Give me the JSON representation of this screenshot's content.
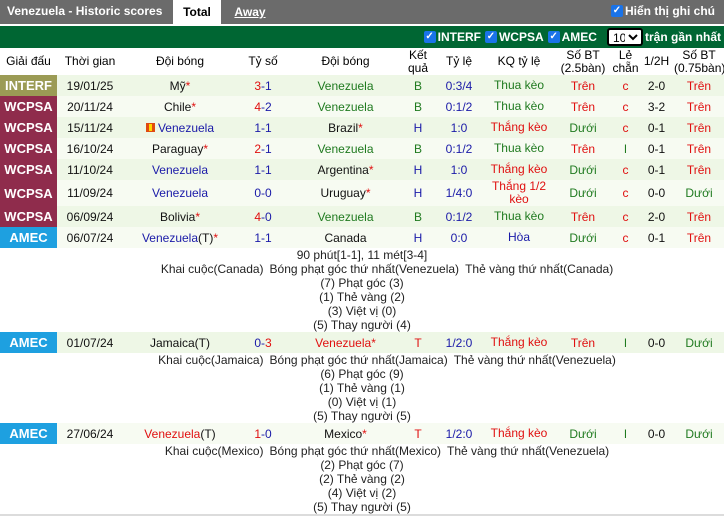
{
  "header": {
    "title": "Venezuela - Historic scores",
    "tabs": [
      {
        "label": "Total",
        "active": true
      },
      {
        "label": "Away",
        "active": false
      }
    ],
    "show_notes_label": "Hiển thị ghi chú",
    "show_notes_checked": true
  },
  "filters": {
    "items": [
      {
        "label": "INTERF",
        "checked": true
      },
      {
        "label": "WCPSA",
        "checked": true
      },
      {
        "label": "AMEC",
        "checked": true
      }
    ],
    "count_value": "10",
    "count_suffix": "trận gần nhất"
  },
  "columns": [
    "Giải đấu",
    "Thời gian",
    "Đội bóng",
    "Tỷ số",
    "Đội bóng",
    "Kết quả",
    "Tỷ lệ",
    "KQ tỷ lệ",
    "Số BT (2.5bàn)",
    "Lẻ chẵn",
    "1/2H",
    "Số BT (0.75bàn)"
  ],
  "colors": {
    "interf": "#9b9b55",
    "wcpsa": "#8f2c4c",
    "amec": "#1ea0e0",
    "green_bar": "#006633",
    "top_bar": "#6b6b6b"
  },
  "matches": [
    {
      "league": "INTERF",
      "date": "19/01/25",
      "home": "Mỹ",
      "home_star": "*",
      "score_home": "3",
      "score_away": "1",
      "away": "Venezuela",
      "away_star": "",
      "result": "B",
      "odds": "0:3/4",
      "odds_result": "Thua kèo",
      "ou": "Trên",
      "oe": "c",
      "half": "2-0",
      "ou2": "Trên"
    },
    {
      "league": "WCPSA",
      "date": "20/11/24",
      "home": "Chile",
      "home_star": "*",
      "score_home": "4",
      "score_away": "2",
      "away": "Venezuela",
      "away_star": "",
      "result": "B",
      "odds": "0:1/2",
      "odds_result": "Thua kèo",
      "ou": "Trên",
      "oe": "c",
      "half": "3-2",
      "ou2": "Trên"
    },
    {
      "league": "WCPSA",
      "date": "15/11/24",
      "home": "Venezuela",
      "home_star": "",
      "score_home": "1",
      "score_away": "1",
      "away": "Brazil",
      "away_star": "*",
      "result": "H",
      "odds": "1:0",
      "odds_result": "Thắng kèo",
      "ou": "Dưới",
      "oe": "c",
      "half": "0-1",
      "ou2": "Trên"
    },
    {
      "league": "WCPSA",
      "date": "16/10/24",
      "home": "Paraguay",
      "home_star": "*",
      "score_home": "2",
      "score_away": "1",
      "away": "Venezuela",
      "away_star": "",
      "result": "B",
      "odds": "0:1/2",
      "odds_result": "Thua kèo",
      "ou": "Trên",
      "oe": "l",
      "half": "0-1",
      "ou2": "Trên"
    },
    {
      "league": "WCPSA",
      "date": "11/10/24",
      "home": "Venezuela",
      "home_star": "",
      "score_home": "1",
      "score_away": "1",
      "away": "Argentina",
      "away_star": "*",
      "result": "H",
      "odds": "1:0",
      "odds_result": "Thắng kèo",
      "ou": "Dưới",
      "oe": "c",
      "half": "0-1",
      "ou2": "Trên"
    },
    {
      "league": "WCPSA",
      "date": "11/09/24",
      "home": "Venezuela",
      "home_star": "",
      "score_home": "0",
      "score_away": "0",
      "away": "Uruguay",
      "away_star": "*",
      "result": "H",
      "odds": "1/4:0",
      "odds_result": "Thắng 1/2 kèo",
      "ou": "Dưới",
      "oe": "c",
      "half": "0-0",
      "ou2": "Dưới"
    },
    {
      "league": "WCPSA",
      "date": "06/09/24",
      "home": "Bolivia",
      "home_star": "*",
      "score_home": "4",
      "score_away": "0",
      "away": "Venezuela",
      "away_star": "",
      "result": "B",
      "odds": "0:1/2",
      "odds_result": "Thua kèo",
      "ou": "Trên",
      "oe": "c",
      "half": "2-0",
      "ou2": "Trên"
    },
    {
      "league": "AMEC",
      "date": "06/07/24",
      "home": "Venezuela",
      "home_suffix": "(T)",
      "home_star": "*",
      "score_home": "1",
      "score_away": "1",
      "away": "Canada",
      "away_star": "",
      "result": "H",
      "odds": "0:0",
      "odds_result": "Hòa",
      "ou": "Dưới",
      "oe": "c",
      "half": "0-1",
      "ou2": "Trên",
      "detail": {
        "line0": "90 phút[1-1], 11 mét[3-4]",
        "events": [
          "Khai cuộc(Canada)",
          "Bóng phạt góc thứ nhất(Venezuela)",
          "Thẻ vàng thứ nhất(Canada)"
        ],
        "stats": [
          "(7) Phạt góc (3)",
          "(1) Thẻ vàng (2)",
          "(3) Việt vị (0)",
          "(5) Thay người (4)"
        ]
      }
    },
    {
      "league": "AMEC",
      "date": "01/07/24",
      "home": "Jamaica",
      "home_suffix": "(T)",
      "home_star": "",
      "score_home": "0",
      "score_away": "3",
      "away": "Venezuela",
      "away_star": "*",
      "result": "T",
      "odds": "1/2:0",
      "odds_result": "Thắng kèo",
      "ou": "Trên",
      "oe": "l",
      "half": "0-0",
      "ou2": "Dưới",
      "detail": {
        "events": [
          "Khai cuộc(Jamaica)",
          "Bóng phạt góc thứ nhất(Jamaica)",
          "Thẻ vàng thứ nhất(Venezuela)"
        ],
        "stats": [
          "(6) Phạt góc (9)",
          "(1) Thẻ vàng (1)",
          "(0) Việt vị (1)",
          "(5) Thay người (5)"
        ]
      }
    },
    {
      "league": "AMEC",
      "date": "27/06/24",
      "home": "Venezuela",
      "home_suffix": "(T)",
      "home_star": "",
      "score_home": "1",
      "score_away": "0",
      "away": "Mexico",
      "away_star": "*",
      "result": "T",
      "odds": "1/2:0",
      "odds_result": "Thắng kèo",
      "ou": "Dưới",
      "oe": "l",
      "half": "0-0",
      "ou2": "Dưới",
      "detail": {
        "events": [
          "Khai cuộc(Mexico)",
          "Bóng phạt góc thứ nhất(Mexico)",
          "Thẻ vàng thứ nhất(Venezuela)"
        ],
        "stats": [
          "(2) Phạt góc (7)",
          "(2) Thẻ vàng (2)",
          "(4) Việt vị (2)",
          "(5) Thay người (5)"
        ]
      }
    }
  ]
}
